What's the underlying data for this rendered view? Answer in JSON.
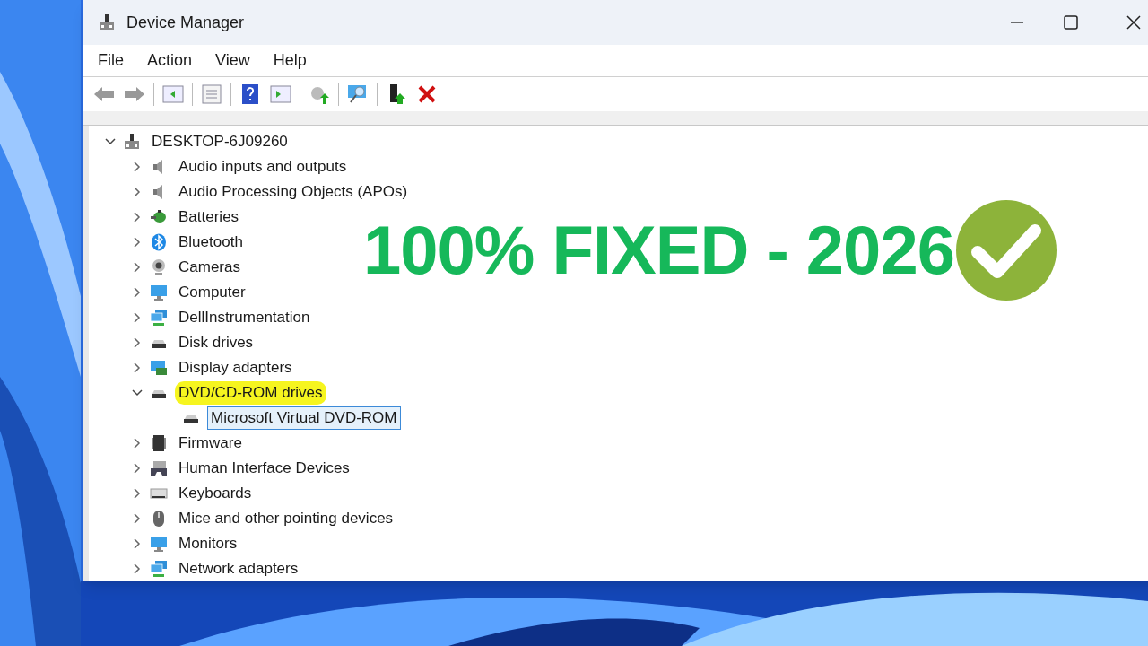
{
  "window": {
    "title": "Device Manager"
  },
  "menu": [
    "File",
    "Action",
    "View",
    "Help"
  ],
  "tree": {
    "label": "DESKTOP-6J09260",
    "kind": "computer",
    "expanded": true,
    "selected": false,
    "children": [
      {
        "label": "Audio inputs and outputs",
        "kind": "speaker",
        "expanded": false,
        "selected": false,
        "highlighted": false
      },
      {
        "label": "Audio Processing Objects (APOs)",
        "kind": "speaker",
        "expanded": false,
        "selected": false,
        "highlighted": false
      },
      {
        "label": "Batteries",
        "kind": "battery",
        "expanded": false,
        "selected": false,
        "highlighted": false
      },
      {
        "label": "Bluetooth",
        "kind": "bluetooth",
        "expanded": false,
        "selected": false,
        "highlighted": false
      },
      {
        "label": "Cameras",
        "kind": "camera",
        "expanded": false,
        "selected": false,
        "highlighted": false
      },
      {
        "label": "Computer",
        "kind": "monitor",
        "expanded": false,
        "selected": false,
        "highlighted": false
      },
      {
        "label": "DellInstrumentation",
        "kind": "network",
        "expanded": false,
        "selected": false,
        "highlighted": false
      },
      {
        "label": "Disk drives",
        "kind": "drive",
        "expanded": false,
        "selected": false,
        "highlighted": false
      },
      {
        "label": "Display adapters",
        "kind": "display",
        "expanded": false,
        "selected": false,
        "highlighted": false
      },
      {
        "label": "DVD/CD-ROM drives",
        "kind": "drive",
        "expanded": true,
        "selected": false,
        "highlighted": true,
        "children": [
          {
            "label": "Microsoft Virtual DVD-ROM",
            "kind": "drive",
            "selected": true
          }
        ]
      },
      {
        "label": "Firmware",
        "kind": "chip",
        "expanded": false,
        "selected": false,
        "highlighted": false
      },
      {
        "label": "Human Interface Devices",
        "kind": "gamepad",
        "expanded": false,
        "selected": false,
        "highlighted": false
      },
      {
        "label": "Keyboards",
        "kind": "keyboard",
        "expanded": false,
        "selected": false,
        "highlighted": false
      },
      {
        "label": "Mice and other pointing devices",
        "kind": "mouse",
        "expanded": false,
        "selected": false,
        "highlighted": false
      },
      {
        "label": "Monitors",
        "kind": "monitor",
        "expanded": false,
        "selected": false,
        "highlighted": false
      },
      {
        "label": "Network adapters",
        "kind": "network",
        "expanded": false,
        "selected": false,
        "highlighted": false
      }
    ]
  },
  "banner": {
    "text": "100% FIXED - 2026"
  }
}
